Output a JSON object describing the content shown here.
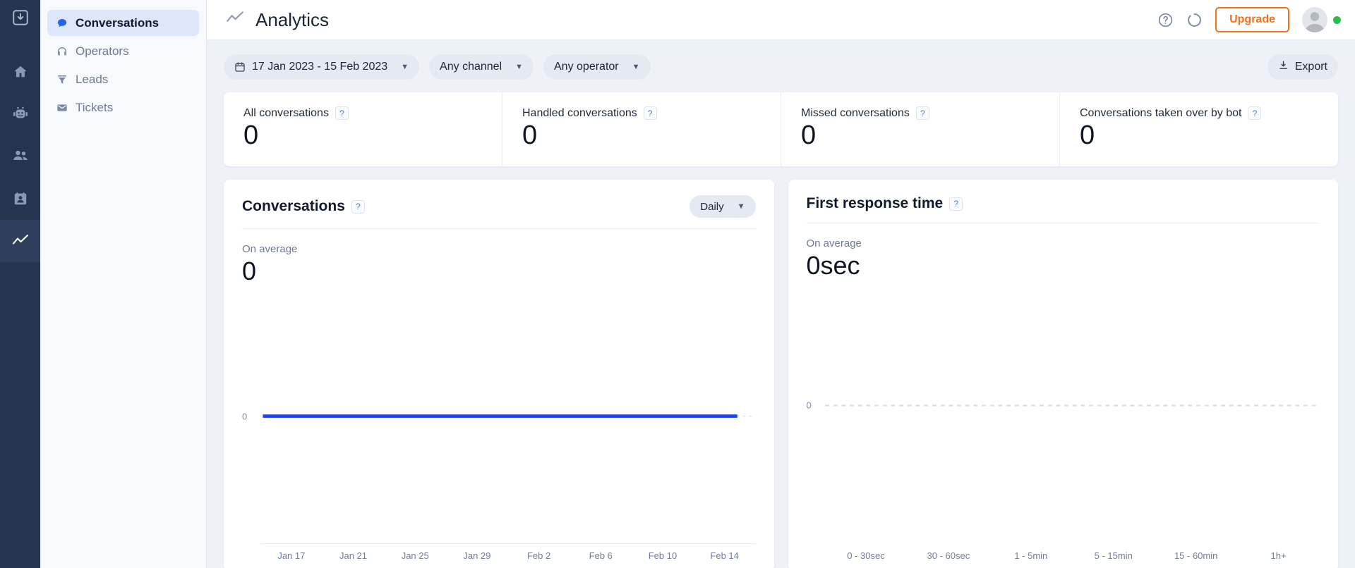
{
  "rail": {
    "logo_icon": "app-logo-icon",
    "items": [
      {
        "name": "home",
        "icon": "home-icon",
        "active": false
      },
      {
        "name": "chatbot",
        "icon": "robot-icon",
        "active": false
      },
      {
        "name": "contacts",
        "icon": "users-icon",
        "active": false
      },
      {
        "name": "directory",
        "icon": "id-card-icon",
        "active": false
      },
      {
        "name": "analytics",
        "icon": "line-chart-icon",
        "active": true
      }
    ]
  },
  "sidebar": {
    "items": [
      {
        "label": "Conversations",
        "icon": "chat-bubble-icon",
        "active": true
      },
      {
        "label": "Operators",
        "icon": "headset-icon",
        "active": false
      },
      {
        "label": "Leads",
        "icon": "funnel-icon",
        "active": false
      },
      {
        "label": "Tickets",
        "icon": "envelope-icon",
        "active": false
      }
    ]
  },
  "header": {
    "title": "Analytics",
    "title_icon": "line-chart-icon",
    "help_icon": "help-circle-icon",
    "sync_icon": "loading-spinner-icon",
    "upgrade_label": "Upgrade",
    "avatar_icon": "user-avatar",
    "presence_color": "#24c24a",
    "accent_color": "#f3701b"
  },
  "filters": {
    "date_range": {
      "label": "17 Jan 2023 - 15 Feb 2023",
      "icon": "calendar-icon"
    },
    "channel": {
      "label": "Any channel"
    },
    "operator": {
      "label": "Any operator"
    },
    "export": {
      "label": "Export",
      "icon": "download-icon"
    }
  },
  "kpis": [
    {
      "label": "All conversations",
      "value": "0",
      "help": "?"
    },
    {
      "label": "Handled conversations",
      "value": "0",
      "help": "?"
    },
    {
      "label": "Missed conversations",
      "value": "0",
      "help": "?"
    },
    {
      "label": "Conversations taken over by bot",
      "value": "0",
      "help": "?"
    }
  ],
  "panels": {
    "conversations": {
      "title": "Conversations",
      "help": "?",
      "granularity": "Daily",
      "avg_label": "On average",
      "avg_value": "0"
    },
    "first_response": {
      "title": "First response time",
      "help": "?",
      "avg_label": "On average",
      "avg_value": "0sec"
    }
  },
  "chart_data": [
    {
      "type": "line",
      "title": "Conversations",
      "xlabel": "",
      "ylabel": "",
      "ylim": [
        0,
        1
      ],
      "yticks": [
        "0"
      ],
      "grid": false,
      "legend": null,
      "line_color": "#1f42e0",
      "x": [
        "Jan 17",
        "Jan 21",
        "Jan 25",
        "Jan 29",
        "Feb 2",
        "Feb 6",
        "Feb 10",
        "Feb 14"
      ],
      "categories": [
        "Jan 17",
        "Jan 21",
        "Jan 25",
        "Jan 29",
        "Feb 2",
        "Feb 6",
        "Feb 10",
        "Feb 14"
      ],
      "values": [
        0,
        0,
        0,
        0,
        0,
        0,
        0,
        0
      ]
    },
    {
      "type": "bar",
      "title": "First response time",
      "xlabel": "",
      "ylabel": "",
      "ylim": [
        0,
        1
      ],
      "yticks": [
        "0"
      ],
      "grid": true,
      "legend": null,
      "categories": [
        "0 - 30sec",
        "30 - 60sec",
        "1 - 5min",
        "5 - 15min",
        "15 - 60min",
        "1h+"
      ],
      "values": [
        0,
        0,
        0,
        0,
        0,
        0
      ]
    }
  ]
}
